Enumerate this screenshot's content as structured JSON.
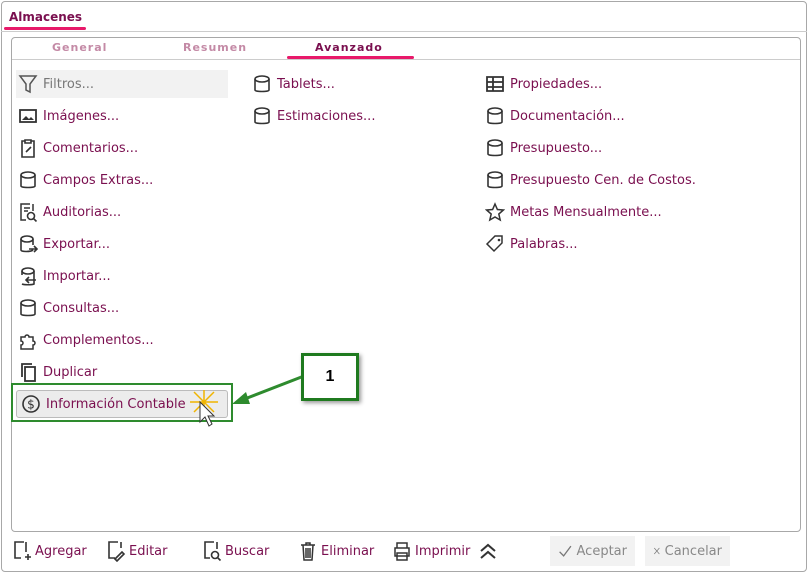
{
  "window": {
    "title": "Almacenes"
  },
  "tabs": [
    {
      "label": "General"
    },
    {
      "label": "Resumen"
    },
    {
      "label": "Avanzado"
    }
  ],
  "col1": [
    {
      "label": "Filtros...",
      "icon": "filter-icon"
    },
    {
      "label": "Imágenes...",
      "icon": "image-icon"
    },
    {
      "label": "Comentarios...",
      "icon": "clipboard-edit-icon"
    },
    {
      "label": "Campos Extras...",
      "icon": "database-icon"
    },
    {
      "label": "Auditorias...",
      "icon": "audit-icon"
    },
    {
      "label": "Exportar...",
      "icon": "database-export-icon"
    },
    {
      "label": "Importar...",
      "icon": "database-import-icon"
    },
    {
      "label": "Consultas...",
      "icon": "database-icon"
    },
    {
      "label": "Complementos...",
      "icon": "puzzle-icon"
    },
    {
      "label": "Duplicar",
      "icon": "copy-icon"
    },
    {
      "label": "Información Contable",
      "icon": "dollar-icon"
    }
  ],
  "col2": [
    {
      "label": "Tablets...",
      "icon": "database-icon"
    },
    {
      "label": "Estimaciones...",
      "icon": "database-icon"
    }
  ],
  "col3": [
    {
      "label": "Propiedades...",
      "icon": "grid-icon"
    },
    {
      "label": "Documentación...",
      "icon": "database-icon"
    },
    {
      "label": "Presupuesto...",
      "icon": "database-icon"
    },
    {
      "label": "Presupuesto Cen. de Costos.",
      "icon": "database-icon"
    },
    {
      "label": "Metas Mensualmente...",
      "icon": "star-icon"
    },
    {
      "label": "Palabras...",
      "icon": "tag-icon"
    }
  ],
  "callout": {
    "number": "1"
  },
  "toolbar": {
    "agregar": "Agregar",
    "editar": "Editar",
    "buscar": "Buscar",
    "eliminar": "Eliminar",
    "imprimir": "Imprimir",
    "aceptar": "Aceptar",
    "cancelar": "Cancelar"
  },
  "colors": {
    "text": "#7a0f4f",
    "accent": "#e8196a",
    "highlight": "#2e8b2e"
  }
}
